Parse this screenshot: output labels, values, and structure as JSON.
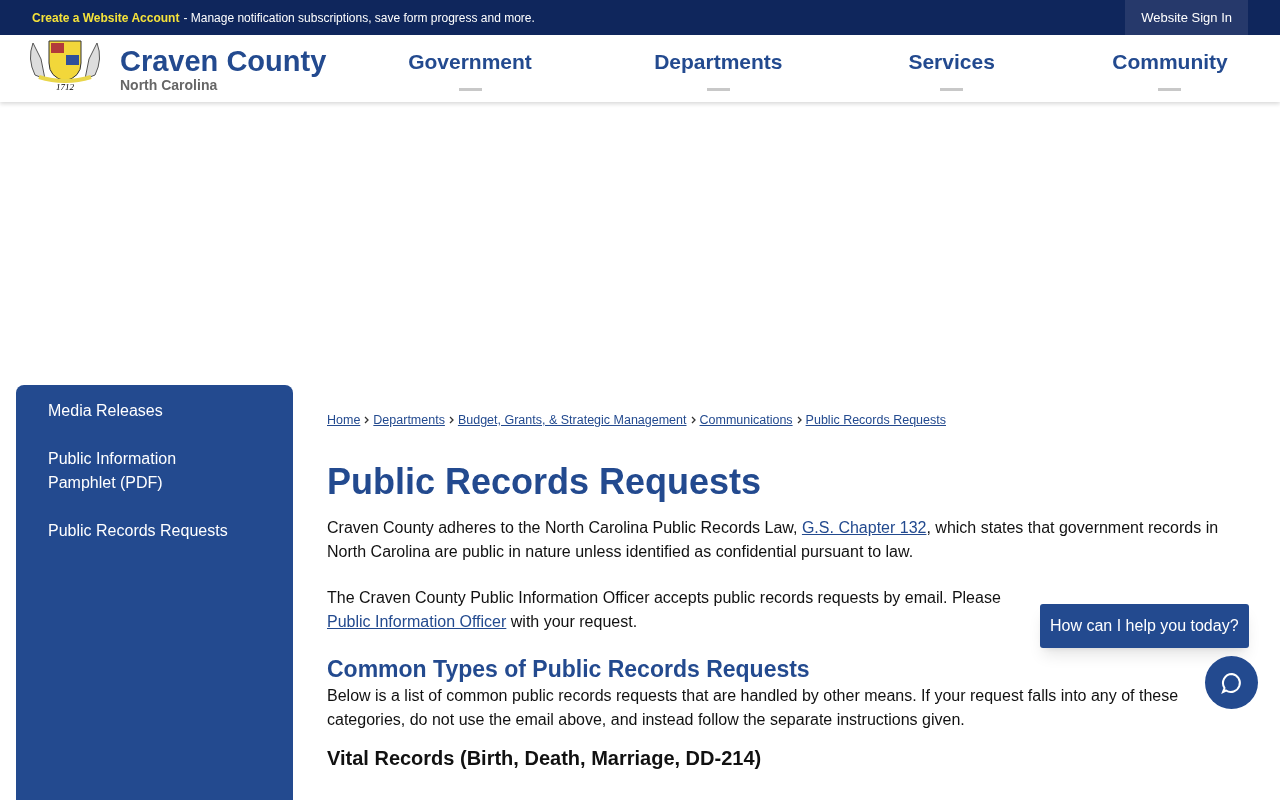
{
  "top_bar": {
    "account_link": "Create a Website Account",
    "message": "- Manage notification subscriptions, save form progress and more.",
    "sign_in": "Website Sign In"
  },
  "header": {
    "logo_year": "1712",
    "title": "Craven County",
    "subtitle": "North Carolina",
    "nav": [
      {
        "label": "Government"
      },
      {
        "label": "Departments"
      },
      {
        "label": "Services"
      },
      {
        "label": "Community"
      }
    ]
  },
  "sidebar": {
    "items": [
      {
        "label": "Media Releases"
      },
      {
        "label": "Public Information Pamphlet (PDF)"
      },
      {
        "label": "Public Records Requests"
      }
    ]
  },
  "breadcrumbs": [
    "Home",
    "Departments",
    "Budget, Grants, & Strategic Management",
    "Communications",
    "Public Records Requests"
  ],
  "title": "Public Records Requests",
  "paragraphs": [
    {
      "parts": [
        {
          "kind": "text",
          "text": "Craven County adheres to the North Carolina Public Records Law, "
        },
        {
          "kind": "link",
          "text": "G.S. Chapter 132"
        },
        {
          "kind": "text",
          "text": ", which states that government records in North Carolina are public in nature unless identified as confidential pursuant to law."
        }
      ]
    },
    {
      "parts": [
        {
          "kind": "text",
          "text": "The Craven County Public Information Officer accepts public records requests by email. Please"
        }
      ]
    },
    {
      "parts": [
        {
          "kind": "link",
          "text": "Public Information Officer"
        },
        {
          "kind": "text",
          "text": " with your request."
        }
      ]
    }
  ],
  "section_heading": "Common Types of Public Records Requests",
  "section_text": "Below is a list of common public records requests that are handled by other means. If your request falls into any of these categories, do not use the email above, and instead follow the separate instructions given.",
  "subheading": "Vital Records (Birth, Death, Marriage, DD-214)",
  "chat": {
    "prompt": "How can I help you today?"
  }
}
